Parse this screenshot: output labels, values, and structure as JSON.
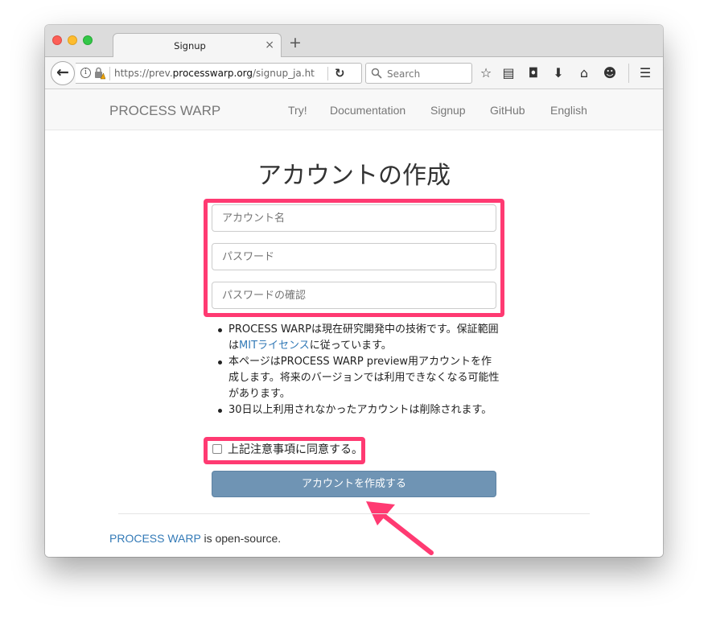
{
  "browser": {
    "tab_title": "Signup",
    "tab_close": "×",
    "new_tab": "+",
    "url_prefix": "https://prev.",
    "url_domain": "processwarp.org",
    "url_path": "/signup_ja.htm",
    "search_placeholder": "Search"
  },
  "navbar": {
    "brand": "PROCESS WARP",
    "links": [
      "Try!",
      "Documentation",
      "Signup",
      "GitHub",
      "English"
    ]
  },
  "form": {
    "heading": "アカウントの作成",
    "account_placeholder": "アカウント名",
    "password_placeholder": "パスワード",
    "password_confirm_placeholder": "パスワードの確認",
    "notes": {
      "n1_before": "PROCESS WARPは現在研究開発中の技術です。保証範囲は",
      "n1_link": "MITライセンス",
      "n1_after": "に従っています。",
      "n2": "本ページはPROCESS WARP preview用アカウントを作成します。将来のバージョンでは利用できなくなる可能性があります。",
      "n3": "30日以上利用されなかったアカウントは削除されます。"
    },
    "agree_label": "上記注意事項に同意する。",
    "submit_label": "アカウントを作成する"
  },
  "footer": {
    "link": "PROCESS WARP",
    "text": " is open-source."
  },
  "colors": {
    "highlight": "#ff3a72",
    "link": "#337ab7",
    "submit_bg": "#6f94b4"
  },
  "icons": [
    "back-arrow-icon",
    "info-icon",
    "lock-warning-icon",
    "reload-icon",
    "search-icon",
    "star-icon",
    "reading-list-icon",
    "pocket-icon",
    "download-icon",
    "home-icon",
    "smiley-icon",
    "hamburger-menu-icon"
  ]
}
